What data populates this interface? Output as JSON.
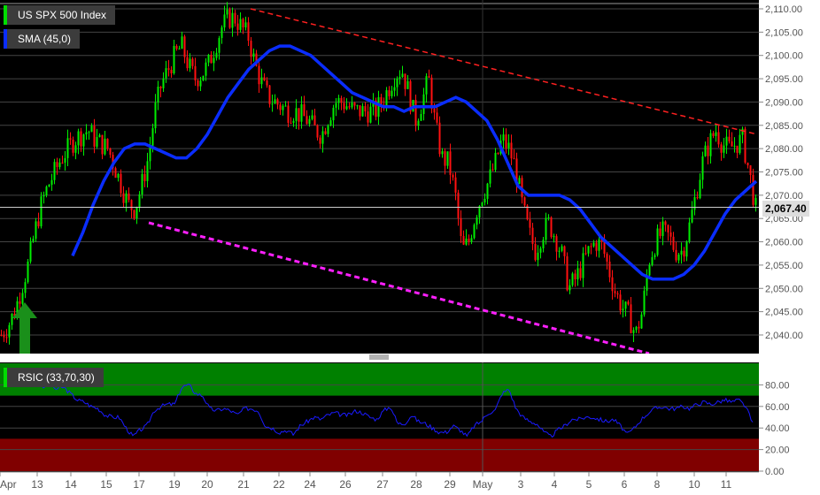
{
  "legends": {
    "price": "US SPX 500 Index",
    "sma": "SMA (45,0)",
    "rsi": "RSIC (33,70,30)"
  },
  "current_price": "2,067.40",
  "colors": {
    "up": "#00ee00",
    "down": "#ff1111",
    "sma": "#0a2dff",
    "rsi": "#1a1aff",
    "overbought": "#008000",
    "oversold": "#800000",
    "resistance": "#ff2020",
    "support": "#ff20ff"
  },
  "chart_data": [
    {
      "type": "candlestick",
      "title": "US SPX 500 Index",
      "ylim": [
        2035,
        2111
      ],
      "yticks": [
        "2,110.00",
        "2,105.00",
        "2,100.00",
        "2,095.00",
        "2,090.00",
        "2,085.00",
        "2,080.00",
        "2,075.00",
        "2,070.00",
        "2,065.00",
        "2,060.00",
        "2,055.00",
        "2,050.00",
        "2,045.00",
        "2,040.00"
      ],
      "ytick_values": [
        2110,
        2105,
        2100,
        2095,
        2090,
        2085,
        2080,
        2075,
        2070,
        2065,
        2060,
        2055,
        2050,
        2045,
        2040
      ],
      "close_series": [
        2040,
        2042,
        2045,
        2050,
        2055,
        2062,
        2068,
        2072,
        2075,
        2078,
        2080,
        2082,
        2083,
        2084,
        2082,
        2081,
        2080,
        2076,
        2072,
        2068,
        2067,
        2072,
        2078,
        2088,
        2094,
        2097,
        2100,
        2102,
        2098,
        2095,
        2096,
        2098,
        2102,
        2106,
        2108,
        2108,
        2106,
        2104,
        2098,
        2094,
        2091,
        2090,
        2089,
        2088,
        2088,
        2087,
        2086,
        2084,
        2083,
        2087,
        2090,
        2090,
        2089,
        2088,
        2088,
        2088,
        2088,
        2090,
        2093,
        2096,
        2097,
        2092,
        2086,
        2090,
        2095,
        2085,
        2078,
        2077,
        2070,
        2058,
        2060,
        2066,
        2070,
        2073,
        2077,
        2082,
        2080,
        2076,
        2068,
        2062,
        2058,
        2062,
        2064,
        2061,
        2057,
        2050,
        2052,
        2055,
        2058,
        2060,
        2059,
        2054,
        2049,
        2046,
        2044,
        2040,
        2045,
        2056,
        2060,
        2062,
        2061,
        2058,
        2058,
        2063,
        2070,
        2077,
        2081,
        2084,
        2081,
        2080,
        2081,
        2082,
        2075,
        2067
      ],
      "sma_series": [
        null,
        null,
        null,
        null,
        null,
        null,
        null,
        2057,
        2062,
        2068,
        2073,
        2077,
        2080,
        2081,
        2081,
        2080,
        2079,
        2078,
        2078,
        2080,
        2083,
        2087,
        2091,
        2094,
        2097,
        2099,
        2101,
        2102,
        2102,
        2101,
        2100,
        2098,
        2096,
        2094,
        2092,
        2091,
        2090,
        2089,
        2089,
        2088,
        2089,
        2089,
        2089,
        2090,
        2091,
        2090,
        2088,
        2086,
        2082,
        2077,
        2072,
        2070,
        2070,
        2070,
        2070,
        2069,
        2067,
        2064,
        2061,
        2059,
        2057,
        2055,
        2053,
        2052,
        2052,
        2052,
        2053,
        2055,
        2058,
        2062,
        2066,
        2069,
        2071,
        2073
      ],
      "annotations": [
        "resistance trendline (red dashed)",
        "support trendline (magenta dashed)",
        "buy arrow"
      ]
    },
    {
      "type": "line",
      "title": "RSIC (33,70,30)",
      "ylim": [
        0,
        100
      ],
      "yticks": [
        "80.00",
        "60.00",
        "40.00",
        "20.00",
        "0.00"
      ],
      "ytick_values": [
        80,
        60,
        40,
        20,
        0
      ],
      "bands": {
        "overbought": [
          70,
          100
        ],
        "oversold": [
          0,
          30
        ]
      },
      "values": [
        78,
        80,
        76,
        78,
        72,
        66,
        64,
        60,
        58,
        52,
        50,
        50,
        40,
        32,
        38,
        42,
        56,
        60,
        62,
        62,
        78,
        80,
        72,
        70,
        58,
        56,
        58,
        56,
        52,
        58,
        58,
        56,
        42,
        40,
        36,
        38,
        34,
        42,
        46,
        50,
        48,
        52,
        54,
        52,
        52,
        56,
        54,
        50,
        48,
        56,
        60,
        44,
        44,
        52,
        46,
        44,
        40,
        36,
        36,
        42,
        38,
        32,
        42,
        46,
        54,
        56,
        72,
        76,
        58,
        50,
        46,
        44,
        36,
        32,
        38,
        42,
        48,
        48,
        50,
        50,
        48,
        46,
        48,
        42,
        34,
        40,
        48,
        54,
        58,
        60,
        58,
        58,
        60,
        58,
        62,
        64,
        62,
        64,
        66,
        64,
        66,
        60,
        44
      ],
      "xticks": [
        "Apr",
        "13",
        "14",
        "15",
        "17",
        "19",
        "20",
        "21",
        "22",
        "24",
        "26",
        "27",
        "28",
        "29",
        "May",
        "3",
        "4",
        "5",
        "6",
        "8",
        "10",
        "11"
      ]
    }
  ]
}
